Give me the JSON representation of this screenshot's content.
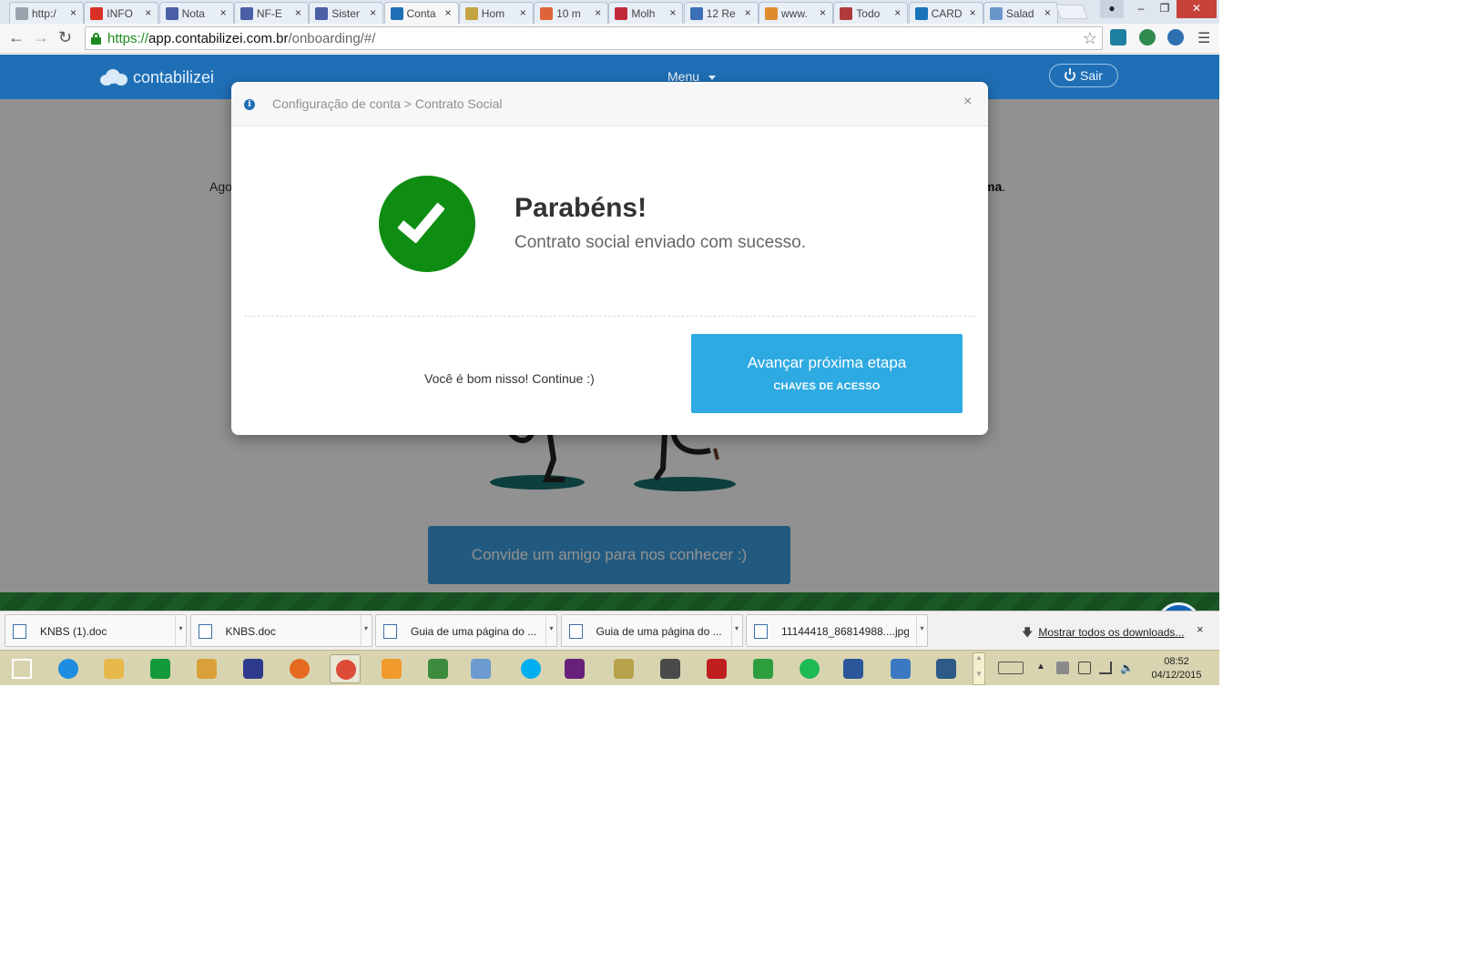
{
  "browser": {
    "tabs": [
      {
        "title": "http:/",
        "favicon": "page-icon",
        "color": "#9aa3ad"
      },
      {
        "title": "INFO",
        "favicon": "gmail-icon",
        "color": "#d93025"
      },
      {
        "title": "Nota",
        "favicon": "nfe-icon",
        "color": "#4b5fa6"
      },
      {
        "title": "NF-E",
        "favicon": "nfe-icon",
        "color": "#4b5fa6"
      },
      {
        "title": "Sister",
        "favicon": "nfe-icon",
        "color": "#4b5fa6"
      },
      {
        "title": "Conta",
        "favicon": "contabilizei-icon",
        "color": "#1f6fb6",
        "active": true
      },
      {
        "title": "Hom",
        "favicon": "chart-icon",
        "color": "#c4a340"
      },
      {
        "title": "10 m",
        "favicon": "pinwheel-icon",
        "color": "#e0643a"
      },
      {
        "title": "Molh",
        "favicon": "molho-icon",
        "color": "#c22a3c"
      },
      {
        "title": "12 Re",
        "favicon": "globe-icon",
        "color": "#3b6fb6"
      },
      {
        "title": "www.",
        "favicon": "google-icon",
        "color": "#e08a2e"
      },
      {
        "title": "Todo",
        "favicon": "todo-icon",
        "color": "#b33a3a"
      },
      {
        "title": "CARD",
        "favicon": "trello-icon",
        "color": "#1a73b8"
      },
      {
        "title": "Salad",
        "favicon": "image-icon",
        "color": "#6a97c9"
      }
    ],
    "tab_close_glyph": "×",
    "url_scheme": "https://",
    "url_host": "app.contabilizei.com.br",
    "url_path": "/onboarding/#/"
  },
  "site": {
    "logo_text": "contabilizei",
    "menu_label": "Menu",
    "logout_label": "Sair",
    "body_text_start": "Ago",
    "body_text_end": "ma",
    "invite_button": "Convide um amigo para nos conhecer :)"
  },
  "modal": {
    "breadcrumb": "Configuração de conta > Contrato Social",
    "close_glyph": "×",
    "title": "Parabéns!",
    "message": "Contrato social enviado com sucesso.",
    "continue_text": "Você é bom nisso! Continue :)",
    "next_button_main": "Avançar próxima etapa",
    "next_button_sub": "CHAVES DE ACESSO",
    "success_color": "#0f8d12",
    "button_color": "#2eaae2"
  },
  "downloads": {
    "items": [
      {
        "name": "KNBS (1).doc",
        "icon": "word-doc-icon"
      },
      {
        "name": "KNBS.doc",
        "icon": "word-doc-icon"
      },
      {
        "name": "Guia de uma página do ...",
        "icon": "document-icon"
      },
      {
        "name": "Guia de uma página do ...",
        "icon": "document-icon"
      },
      {
        "name": "11144418_86814988....jpg",
        "icon": "image-file-icon"
      }
    ],
    "show_all": "Mostrar todos os downloads...",
    "close_glyph": "×"
  },
  "taskbar": {
    "apps": [
      {
        "name": "windows-start-icon",
        "color": "#ffffff"
      },
      {
        "name": "internet-explorer-icon",
        "color": "#1e8ce0"
      },
      {
        "name": "file-explorer-icon",
        "color": "#e6b94a"
      },
      {
        "name": "windows-store-icon",
        "color": "#139a3b"
      },
      {
        "name": "stopwatch-icon",
        "color": "#d9a03a"
      },
      {
        "name": "help-app-icon",
        "color": "#2e3b8c"
      },
      {
        "name": "firefox-icon",
        "color": "#e66a1f"
      },
      {
        "name": "chrome-icon",
        "color": "#dd4b39",
        "active": true
      },
      {
        "name": "media-player-icon",
        "color": "#f29a2e"
      },
      {
        "name": "project-icon",
        "color": "#3d8b3d"
      },
      {
        "name": "calculator-icon",
        "color": "#6b9bd1"
      },
      {
        "name": "skype-icon",
        "color": "#00aff0"
      },
      {
        "name": "visual-studio-icon",
        "color": "#68217a"
      },
      {
        "name": "tools-icon",
        "color": "#b8a24a"
      },
      {
        "name": "sublime-text-icon",
        "color": "#4a4a4a"
      },
      {
        "name": "filezilla-icon",
        "color": "#bf1f1f"
      },
      {
        "name": "fiddler-icon",
        "color": "#2c9e3e"
      },
      {
        "name": "spotify-icon",
        "color": "#1db954"
      },
      {
        "name": "word-icon",
        "color": "#2b579a"
      },
      {
        "name": "powershell-icon",
        "color": "#3a79c2"
      },
      {
        "name": "mysql-workbench-icon",
        "color": "#2e5a88"
      }
    ],
    "time": "08:52",
    "date": "04/12/2015"
  }
}
